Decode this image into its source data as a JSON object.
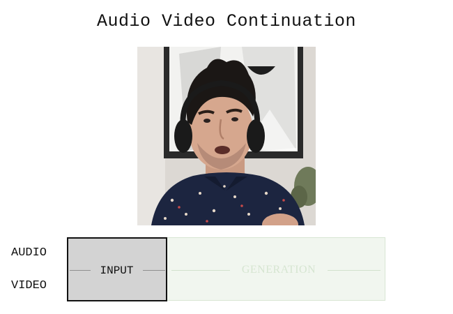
{
  "title": "Audio Video Continuation",
  "tracks": {
    "audio_label": "AUDIO",
    "video_label": "VIDEO"
  },
  "timeline": {
    "input_label": "INPUT",
    "generation_label": "GENERATION",
    "input_fraction": 0.31
  },
  "colors": {
    "input_fill": "#d3d3d3",
    "generation_fill": "#f1f6ef",
    "generation_text": "#d6e5d1",
    "shirt": "#1c2540",
    "headphones": "#1a1a1a"
  },
  "video_frame": {
    "subject": "man with headphones speaking, patterned navy shirt"
  }
}
